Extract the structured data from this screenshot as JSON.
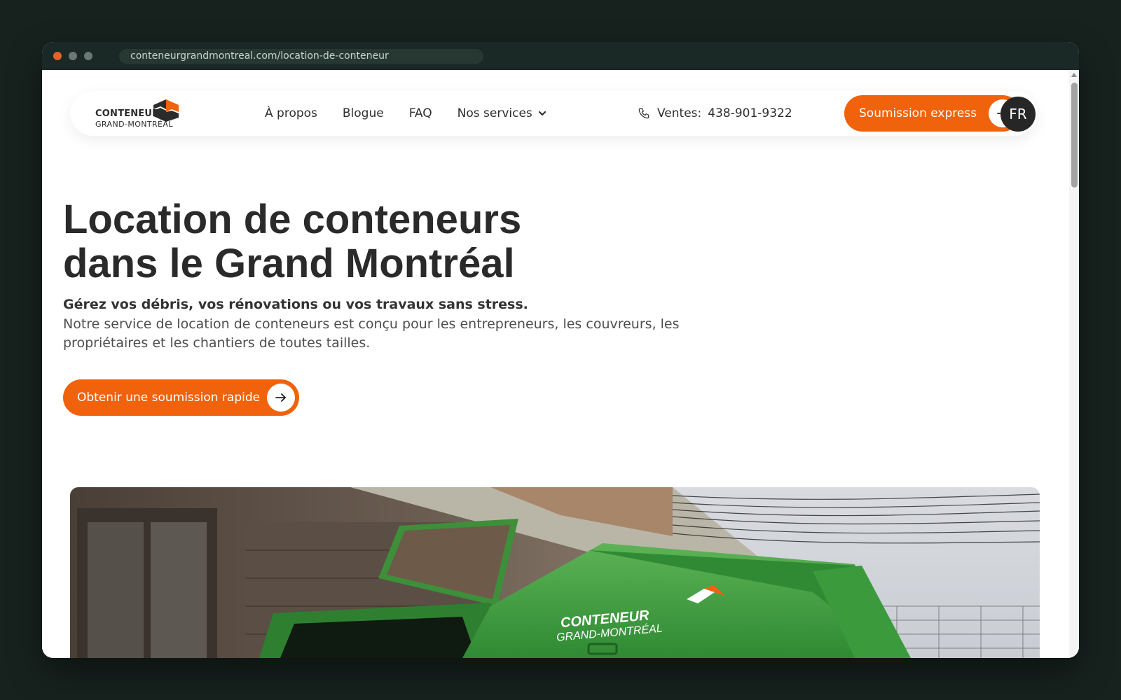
{
  "browser": {
    "url": "conteneurgrandmontreal.com/location-de-conteneur"
  },
  "logo": {
    "word": "CONTENEUR",
    "sub": "GRAND-MONTRÉAL"
  },
  "nav": {
    "links": [
      "À propos",
      "Blogue",
      "FAQ"
    ],
    "services_label": "Nos services",
    "phone_label": "Ventes:",
    "phone_number": "438-901-9322",
    "cta_label": "Soumission express",
    "language": "FR"
  },
  "hero": {
    "title_line1": "Location de conteneurs",
    "title_line2": "dans le Grand Montréal",
    "subtitle": "Gérez vos débris, vos rénovations ou vos travaux sans stress.",
    "description": "Notre service de location de conteneurs est conçu pour les entrepreneurs, les couvreurs, les propriétaires et les chantiers de toutes tailles.",
    "cta_label": "Obtenir une soumission rapide"
  },
  "image": {
    "container_brand": "CONTENEUR",
    "container_sub": "GRAND-MONTRÉAL"
  },
  "colors": {
    "accent": "#f0620c",
    "dark": "#2a2a2a",
    "background": "#17221f",
    "container_green": "#3f9a3c"
  }
}
